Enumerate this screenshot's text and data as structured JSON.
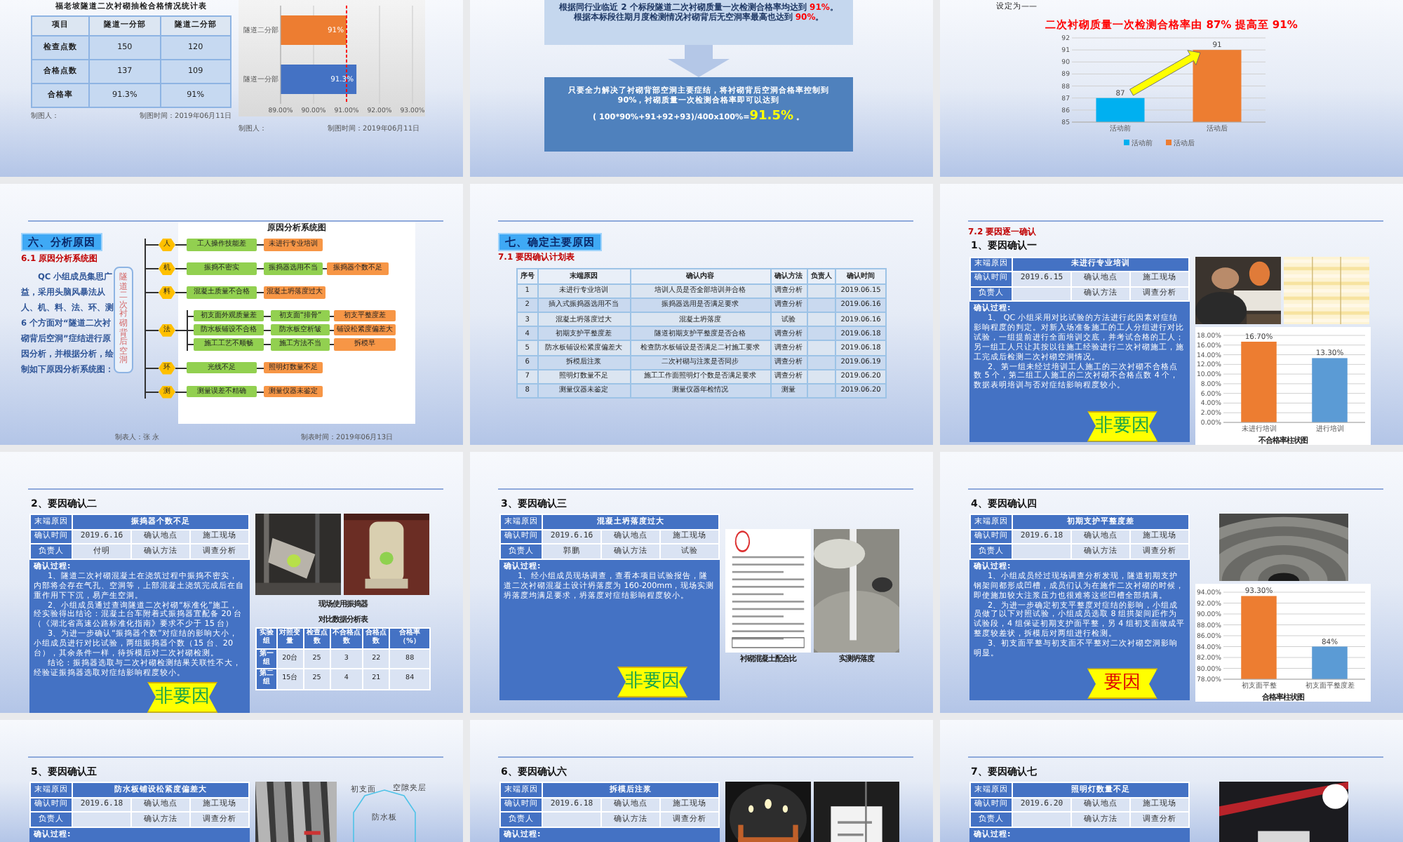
{
  "slides": [
    {
      "kind": "stats",
      "title": "福老坡隧道二次衬砌抽检合格情况统计表",
      "table": {
        "columns": [
          "项目",
          "隧道一分部",
          "隧道二分部"
        ],
        "rows": [
          [
            "检查点数",
            "150",
            "120"
          ],
          [
            "合格点数",
            "137",
            "109"
          ],
          [
            "合格率",
            "91.3%",
            "91%"
          ]
        ]
      },
      "footer": [
        "制图人：",
        "制图时间：2019年06月11日"
      ],
      "chart_data": {
        "type": "bar",
        "orientation": "horizontal",
        "categories": [
          "隧道二分部",
          "隧道一分部"
        ],
        "series": [
          {
            "color": "#ed7d31",
            "values": [
              91,
              null
            ]
          },
          {
            "color": "#4472c4",
            "values": [
              null,
              91.3
            ]
          }
        ],
        "xlim": [
          89,
          93
        ],
        "xticks": [
          {
            "value": 89,
            "label": "89.00%"
          },
          {
            "value": 90,
            "label": "90.00%"
          },
          {
            "value": 91,
            "label": "91.00%"
          },
          {
            "value": 92,
            "label": "92.00%"
          },
          {
            "value": 93,
            "label": "93.00%"
          }
        ],
        "value_labels": [
          "91%",
          "91.3%"
        ],
        "grid": true,
        "ref_lines": [
          {
            "value": 91,
            "axis": "x",
            "color": "#ff0000"
          }
        ]
      },
      "chart_footer": [
        "制图人：",
        "制图时间：2019年06月11日"
      ]
    },
    {
      "kind": "target",
      "premise": "根据同行业临近 2 个标段隧道二次衬砌质量一次检测合格率均达到 **91%**。根据本标段往期月度检测情况衬砌背后无空洞率最高也达到 **90%**。",
      "conclusion": "只要全力解决了衬砌背部空洞主要症结，将衬砌背后空洞合格率控制到 90%，衬砌质量一次检测合格率即可以达到",
      "formula": "( 100*90%+91+92+93)/400x100%=**91.5%** 。"
    },
    {
      "kind": "goal",
      "lead": "设定为——",
      "headline": "二次衬砌质量一次检测合格率由 87% 提高至 91%",
      "chart_data": {
        "type": "bar",
        "categories": [
          "活动前",
          "活动后"
        ],
        "series": [
          {
            "name": "活动前",
            "color": "#00b0f0",
            "values": [
              87,
              null
            ]
          },
          {
            "name": "活动后",
            "color": "#ed7d31",
            "values": [
              null,
              91
            ]
          }
        ],
        "ylim": [
          85,
          92
        ],
        "yticks": [
          85,
          86,
          87,
          88,
          89,
          90,
          91,
          92
        ],
        "value_labels": [
          "87",
          "91"
        ],
        "grid": true,
        "legend": "bottom"
      }
    },
    {
      "kind": "fishbone",
      "section": "六、分析原因",
      "subsection": "6.1 原因分析系统图",
      "intro": "QC 小组成员集思广益，采用头脑风暴法从人、机、料、法、环、测 6 个方面对“隧道二次衬砌背后空洞”症结进行原因分析，并根据分析，绘制如下原因分析系统图：",
      "problem": "隧道二次衬砌背后空洞",
      "diagram_title": "原因分析系统图",
      "branches": [
        {
          "label": "人",
          "chains": [
            [
              "工人操作技能差",
              "未进行专业培训"
            ]
          ]
        },
        {
          "label": "机",
          "chains": [
            [
              "振捣不密实",
              "振捣器选用不当",
              "振捣器个数不足"
            ]
          ]
        },
        {
          "label": "料",
          "chains": [
            [
              "混凝土质量不合格",
              "混凝土坍落度过大"
            ]
          ]
        },
        {
          "label": "法",
          "chains": [
            [
              "初支面外观质量差",
              "初支面“排骨”",
              "初支平整度差"
            ],
            [
              "防水板铺设不合格",
              "防水板空析皱",
              "铺设松紧度偏差大"
            ],
            [
              "施工工艺不顺畅",
              "施工方法不当",
              "拆模早"
            ]
          ]
        },
        {
          "label": "环",
          "chains": [
            [
              "光线不足",
              "照明灯数量不足"
            ]
          ]
        },
        {
          "label": "测",
          "chains": [
            [
              "测量误差不精确",
              "测量仪器未鉴定"
            ]
          ]
        }
      ],
      "footer": [
        "制表人：张 永",
        "制表时间：2019年06月13日"
      ]
    },
    {
      "kind": "plan",
      "section": "七、确定主要原因",
      "subsection": "7.1 要因确认计划表",
      "table": {
        "columns": [
          "序号",
          "末端原因",
          "确认内容",
          "确认方法",
          "负责人",
          "确认时间"
        ],
        "rows": [
          [
            "1",
            "未进行专业培训",
            "培训人员是否全部培训并合格",
            "调查分析",
            "",
            "2019.06.15"
          ],
          [
            "2",
            "插入式振捣器选用不当",
            "振捣器选用是否满足要求",
            "调查分析",
            "",
            "2019.06.16"
          ],
          [
            "3",
            "混凝土坍落度过大",
            "混凝土坍落度",
            "试验",
            "",
            "2019.06.16"
          ],
          [
            "4",
            "初期支护平整度差",
            "隧道初期支护平整度是否合格",
            "调查分析",
            "",
            "2019.06.18"
          ],
          [
            "5",
            "防水板铺设松紧度偏差大",
            "检查防水板铺设是否满足二衬施工要求",
            "调查分析",
            "",
            "2019.06.18"
          ],
          [
            "6",
            "拆模后注浆",
            "二次衬砌与注浆是否同步",
            "调查分析",
            "",
            "2019.06.19"
          ],
          [
            "7",
            "照明灯数量不足",
            "施工工作面照明灯个数是否满足要求",
            "调查分析",
            "",
            "2019.06.20"
          ],
          [
            "8",
            "测量仪器未鉴定",
            "测量仪器年检情况",
            "测量",
            "",
            "2019.06.20"
          ]
        ]
      }
    },
    {
      "kind": "confirm",
      "section": "7.2 要因逐一确认",
      "title": "1、要因确认一",
      "info": {
        "labels": [
          "末端原因",
          "确认时间",
          "确认地点",
          "负责人",
          "确认方法"
        ],
        "cause": "未进行专业培训",
        "time": "2019.6.15",
        "place": "施工现场",
        "method": "调查分析"
      },
      "process_title": "确认过程:",
      "process": [
        "1、 QC 小组采用对比试验的方法进行此因素对症结影响程度的判定。对新入场准备施工的工人分组进行对比试验，一组提前进行全面培训交底，并考试合格的工人；另一组工人只让其按以往施工经验进行二次衬砌施工，施工完成后检测二次衬砌空洞情况。",
        "2、第一组未经过培训工人施工的二次衬砌不合格点数 5 个，第二组工人施工的二次衬砌不合格点数 4 个，数据表明培训与否对症结影响程度较小。"
      ],
      "verdict": {
        "kind": "non_key",
        "text": "非要因"
      },
      "media": [
        {
          "kind": "picture"
        },
        {
          "kind": "picture"
        },
        {
          "kind": "chart",
          "chart_data": {
            "type": "bar",
            "title": "不合格率柱状图",
            "categories": [
              "未进行培训",
              "进行培训"
            ],
            "series": [
              {
                "color": "#ed7d31",
                "values": [
                  16.7,
                  null
                ]
              },
              {
                "color": "#5b9bd5",
                "values": [
                  null,
                  13.3
                ]
              }
            ],
            "ylim": [
              0,
              18
            ],
            "yticks": [
              {
                "value": 0,
                "label": "0.00%"
              },
              {
                "value": 2,
                "label": "2.00%"
              },
              {
                "value": 4,
                "label": "4.00%"
              },
              {
                "value": 6,
                "label": "6.00%"
              },
              {
                "value": 8,
                "label": "8.00%"
              },
              {
                "value": 10,
                "label": "10.00%"
              },
              {
                "value": 12,
                "label": "12.00%"
              },
              {
                "value": 14,
                "label": "14.00%"
              },
              {
                "value": 16,
                "label": "16.00%"
              },
              {
                "value": 18,
                "label": "18.00%"
              }
            ],
            "value_labels": [
              "16.70%",
              "13.30%"
            ],
            "grid": true
          }
        }
      ]
    },
    {
      "kind": "confirm",
      "title": "2、要因确认二",
      "info": {
        "labels": [
          "末端原因",
          "确认时间",
          "确认地点",
          "负责人",
          "确认方法"
        ],
        "cause": "振捣器个数不足",
        "time": "2019.6.16",
        "place": "施工现场",
        "owner": "付明",
        "method": "调查分析"
      },
      "process_title": "确认过程:",
      "process": [
        "1、隧道二次衬砌混凝土在浇筑过程中振捣不密实，内部将会存在气孔、空洞等，上部混凝土浇筑完成后在自重作用下下沉，易产生空洞。",
        "2、小组成员通过查询隧道二次衬砌“标准化”施工，经实验得出结论：混凝土台车附着式振捣器宜配备 20 台（《湖北省高速公路标准化指南》要求不少于 15 台）",
        "3、为进一步确认“振捣器个数”对症结的影响大小，小组成员进行对比试验，两组振捣器个数（15 台、20 台），其余条件一样，待拆模后对二次衬砌检测。",
        "结论：振捣器选取与二次衬砌检测结果关联性不大，经验证振捣器选取对症结影响程度较小。"
      ],
      "verdict": {
        "kind": "non_key",
        "text": "非要因"
      },
      "media": [
        {
          "kind": "picture"
        },
        {
          "kind": "picture"
        },
        {
          "kind": "caption",
          "text": "现场使用振捣器"
        },
        {
          "kind": "caption",
          "text": "对比数据分析表"
        },
        {
          "kind": "table",
          "columns": [
            "实验组",
            "对照变量",
            "检查点数",
            "不合格点数",
            "合格点数",
            "合格率（%）"
          ],
          "rows": [
            [
              "第一组",
              "20台",
              "25",
              "3",
              "22",
              "88"
            ],
            [
              "第二组",
              "15台",
              "25",
              "4",
              "21",
              "84"
            ]
          ]
        }
      ]
    },
    {
      "kind": "confirm",
      "title": "3、要因确认三",
      "info": {
        "labels": [
          "末端原因",
          "确认时间",
          "确认地点",
          "负责人",
          "确认方法"
        ],
        "cause": "混凝土坍落度过大",
        "time": "2019.6.16",
        "place": "施工现场",
        "owner": "郭鹏",
        "method": "试验"
      },
      "process_title": "确认过程:",
      "process": [
        "1、经小组成员现场调查，查看本项目试验报告，隧道二次衬砌混凝土设计坍落度为 160-200mm，现场实测坍落度均满足要求，坍落度对症结影响程度较小。"
      ],
      "verdict": {
        "kind": "non_key",
        "text": "非要因"
      },
      "media": [
        {
          "kind": "picture"
        },
        {
          "kind": "picture"
        },
        {
          "kind": "caption",
          "text": "衬砌混凝土配合比"
        },
        {
          "kind": "caption",
          "text": "实测坍落度"
        }
      ]
    },
    {
      "kind": "confirm",
      "title": "4、要因确认四",
      "info": {
        "labels": [
          "末端原因",
          "确认时间",
          "确认地点",
          "负责人",
          "确认方法"
        ],
        "cause": "初期支护平整度差",
        "time": "2019.6.18",
        "place": "施工现场",
        "method": "调查分析"
      },
      "process_title": "确认过程:",
      "process": [
        "1、小组成员经过现场调查分析发现，隧道初期支护钢架间都形成凹槽，成员们认为在施作二次衬砌的时候，即使施加较大注浆压力也很难将这些凹槽全部填满。",
        "2、为进一步确定初支平整度对症结的影响，小组成员做了以下对照试验，小组成员选取 8 组拱架间距作为试验段，4 组保证初期支护面平整，另 4 组初支面做成平整度较差状，拆模后对两组进行检测。",
        "3、初支面平整与初支面不平整对二次衬砌空洞影响明显。"
      ],
      "verdict": {
        "kind": "key",
        "text": "要因"
      },
      "media": [
        {
          "kind": "picture"
        },
        {
          "kind": "chart",
          "chart_data": {
            "type": "bar",
            "title": "合格率柱状图",
            "categories": [
              "初支面平整",
              "初支面平整度差"
            ],
            "series": [
              {
                "color": "#ed7d31",
                "values": [
                  93.3,
                  null
                ]
              },
              {
                "color": "#5b9bd5",
                "values": [
                  null,
                  84
                ]
              }
            ],
            "ylim": [
              78,
              94
            ],
            "yticks": [
              {
                "value": 78,
                "label": "78.00%"
              },
              {
                "value": 80,
                "label": "80.00%"
              },
              {
                "value": 82,
                "label": "82.00%"
              },
              {
                "value": 84,
                "label": "84.00%"
              },
              {
                "value": 86,
                "label": "86.00%"
              },
              {
                "value": 88,
                "label": "88.00%"
              },
              {
                "value": 90,
                "label": "90.00%"
              },
              {
                "value": 92,
                "label": "92.00%"
              },
              {
                "value": 94,
                "label": "94.00%"
              }
            ],
            "value_labels": [
              "93.30%",
              "84%"
            ],
            "grid": true
          }
        }
      ]
    },
    {
      "kind": "confirm",
      "title": "5、要因确认五",
      "info": {
        "labels": [
          "末端原因",
          "确认时间",
          "确认地点",
          "负责人",
          "确认方法"
        ],
        "cause": "防水板铺设松紧度偏差大",
        "time": "2019.6.18",
        "place": "施工现场",
        "method": "调查分析"
      },
      "process_title": "确认过程:",
      "media": [
        {
          "kind": "picture"
        },
        {
          "kind": "diagram",
          "labels": [
            "初支面",
            "空隙夹层",
            "防水板"
          ]
        }
      ]
    },
    {
      "kind": "confirm",
      "title": "6、要因确认六",
      "info": {
        "labels": [
          "末端原因",
          "确认时间",
          "确认地点",
          "负责人",
          "确认方法"
        ],
        "cause": "拆模后注浆",
        "time": "2019.6.18",
        "place": "施工现场",
        "method": "调查分析"
      },
      "process_title": "确认过程:",
      "media": [
        {
          "kind": "picture"
        },
        {
          "kind": "picture"
        }
      ]
    },
    {
      "kind": "confirm",
      "title": "7、要因确认七",
      "info": {
        "labels": [
          "末端原因",
          "确认时间",
          "确认地点",
          "负责人",
          "确认方法"
        ],
        "cause": "照明灯数量不足",
        "time": "2019.6.20",
        "place": "施工现场",
        "method": "调查分析"
      },
      "process_title": "确认过程:",
      "media": [
        {
          "kind": "picture"
        }
      ]
    }
  ]
}
